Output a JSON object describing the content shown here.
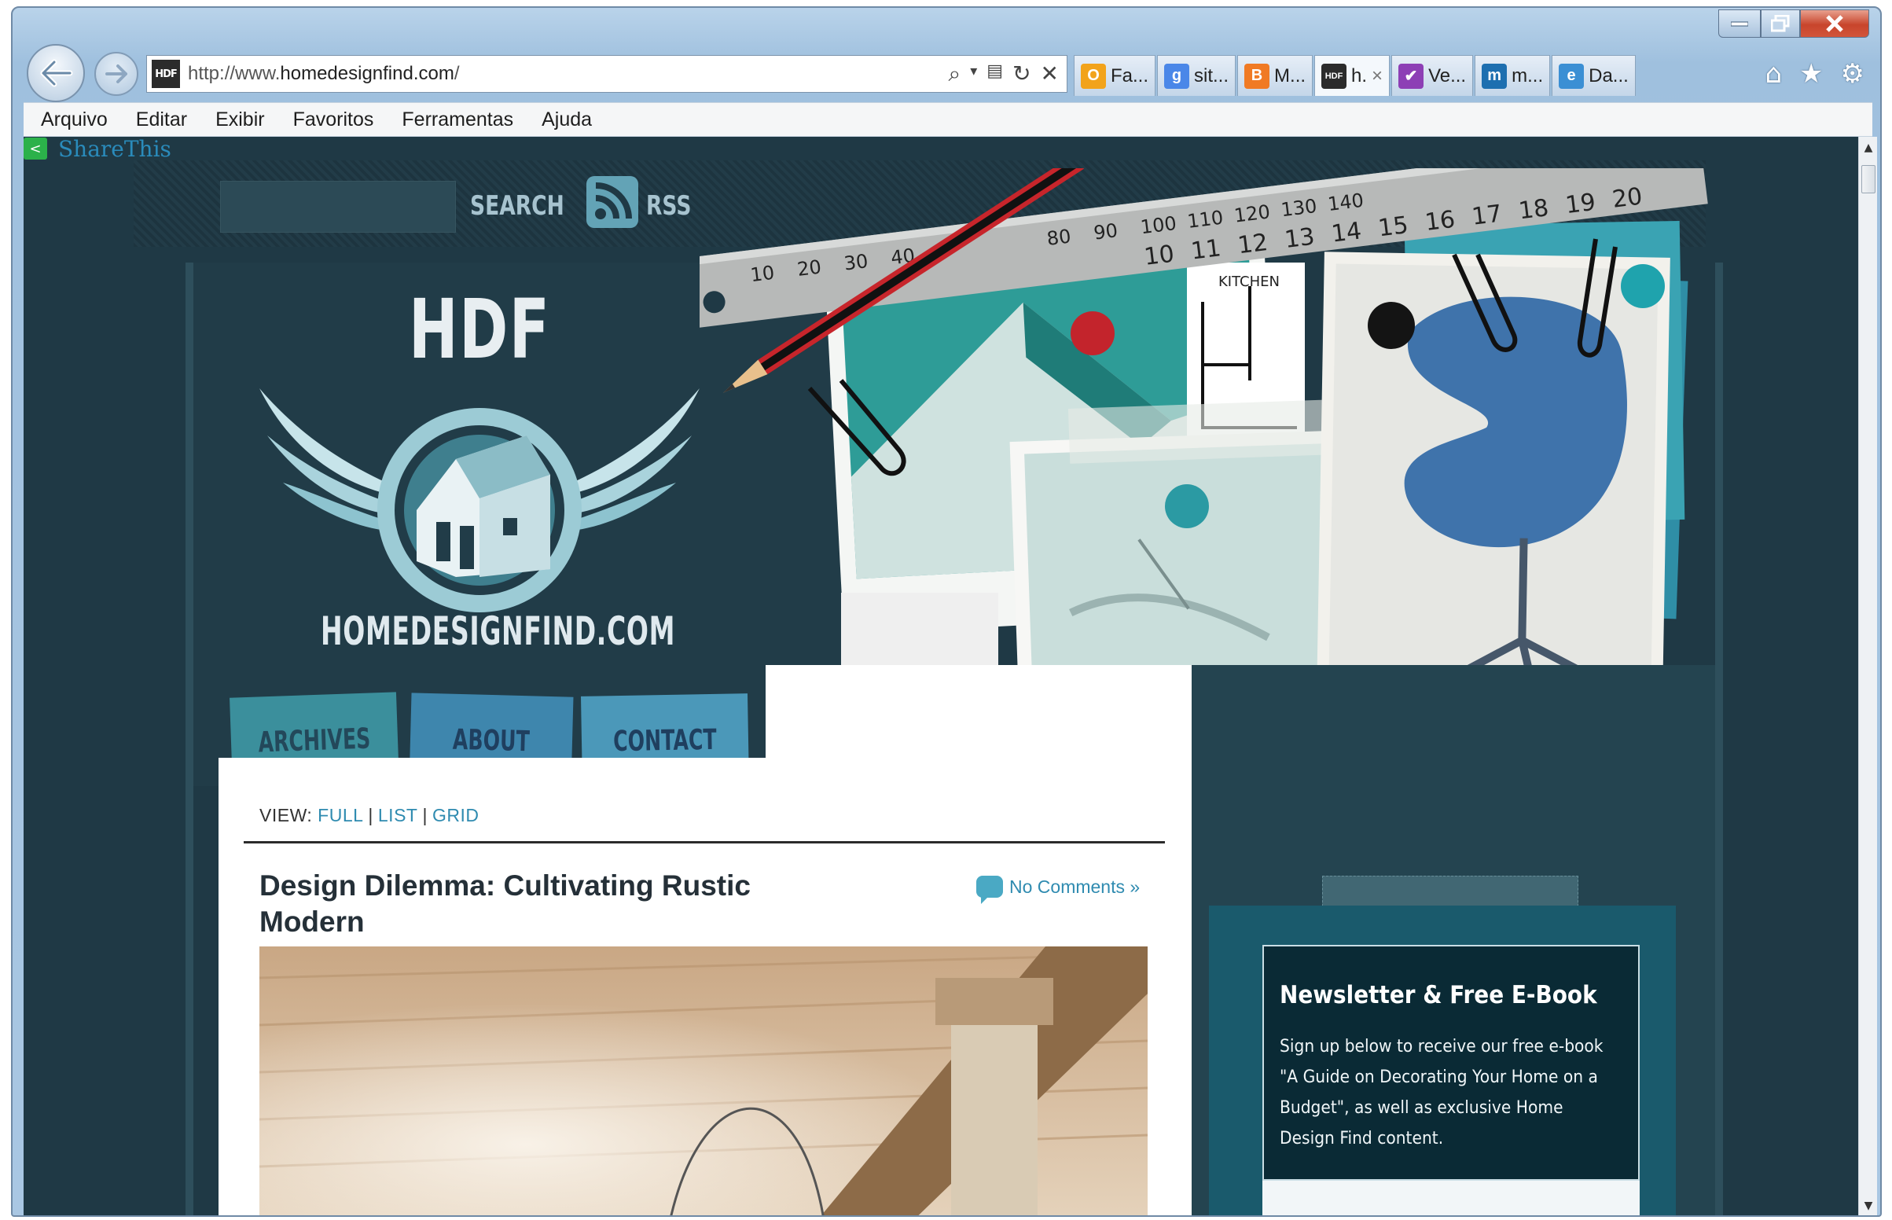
{
  "browser": {
    "address_url_prefix": "http://www.",
    "address_url_domain": "homedesignfind.com",
    "address_url_suffix": "/",
    "favicon_text": "HDF",
    "tabs": [
      {
        "icon": "outlook-icon",
        "color": "#f2a31b",
        "icon_text": "O",
        "label": "Fa..."
      },
      {
        "icon": "google-icon",
        "color": "#4a87e8",
        "icon_text": "g",
        "label": "sit..."
      },
      {
        "icon": "blogger-icon",
        "color": "#f07a24",
        "icon_text": "B",
        "label": "M..."
      },
      {
        "icon": "hdf-favicon-icon",
        "color": "#2b2b2b",
        "icon_text": "HDF",
        "label": "h.",
        "close": "×",
        "active": true
      },
      {
        "icon": "checkbox-app-icon",
        "color": "#8d3fb5",
        "icon_text": "✔",
        "label": "Ve..."
      },
      {
        "icon": "m-app-icon",
        "color": "#1d6fb0",
        "icon_text": "m",
        "label": "m..."
      },
      {
        "icon": "ie-icon",
        "color": "#3b8fd4",
        "icon_text": "e",
        "label": "Da..."
      }
    ]
  },
  "menu": [
    "Arquivo",
    "Editar",
    "Exibir",
    "Favoritos",
    "Ferramentas",
    "Ajuda"
  ],
  "sharethis": "ShareThis",
  "header": {
    "search_label": "SEARCH",
    "rss_label": "RSS",
    "logo_text": "HDF",
    "site_name": "HOMEDESIGNFIND.COM"
  },
  "nav": {
    "archives": "ARCHIVES",
    "about": "ABOUT",
    "contact": "CONTACT"
  },
  "view": {
    "label": "VIEW:",
    "full": "FULL",
    "list": "LIST",
    "grid": "GRID",
    "sep": "|"
  },
  "post": {
    "title": "Design Dilemma: Cultivating Rustic Modern",
    "comments": "No Comments »"
  },
  "sidebar": {
    "newsletter_title": "Newsletter & Free E-Book",
    "newsletter_text": "Sign up below to receive our free e-book \"A Guide on Decorating Your Home on a Budget\", as well as exclusive Home Design Find content."
  },
  "colors": {
    "page_bg": "#1f3945",
    "accent_link": "#2f8bb0",
    "widget_bg": "#1a5a6c"
  }
}
